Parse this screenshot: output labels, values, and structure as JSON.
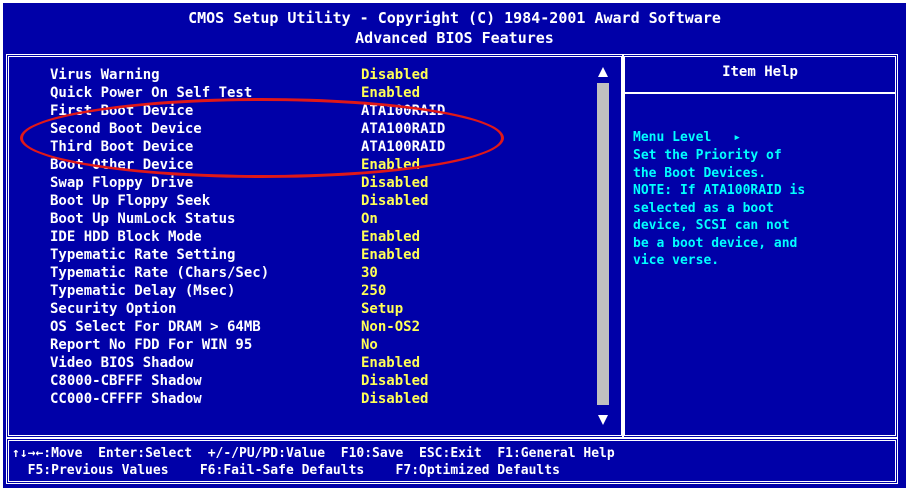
{
  "header": {
    "line1": "CMOS Setup Utility - Copyright (C) 1984-2001 Award Software",
    "line2": "Advanced BIOS Features"
  },
  "settings": [
    {
      "label": "Virus Warning",
      "value": "Disabled"
    },
    {
      "label": "Quick Power On Self Test",
      "value": "Enabled"
    },
    {
      "label": "First Boot Device",
      "value": "ATA100RAID"
    },
    {
      "label": "Second Boot Device",
      "value": "ATA100RAID"
    },
    {
      "label": "Third Boot Device",
      "value": "ATA100RAID"
    },
    {
      "label": "Boot Other Device",
      "value": "Enabled"
    },
    {
      "label": "Swap Floppy Drive",
      "value": "Disabled"
    },
    {
      "label": "Boot Up Floppy Seek",
      "value": "Disabled"
    },
    {
      "label": "Boot Up NumLock Status",
      "value": "On"
    },
    {
      "label": "IDE HDD Block Mode",
      "value": "Enabled"
    },
    {
      "label": "Typematic Rate Setting",
      "value": "Enabled"
    },
    {
      "label": "Typematic Rate (Chars/Sec)",
      "value": "30"
    },
    {
      "label": "Typematic Delay (Msec)",
      "value": "250"
    },
    {
      "label": "Security Option",
      "value": "Setup"
    },
    {
      "label": "OS Select For DRAM > 64MB",
      "value": "Non-OS2"
    },
    {
      "label": "Report No FDD For WIN 95",
      "value": "No"
    },
    {
      "label": "Video BIOS Shadow",
      "value": "Enabled"
    },
    {
      "label": "C8000-CBFFF Shadow",
      "value": "Disabled"
    },
    {
      "label": "CC000-CFFFF Shadow",
      "value": "Disabled"
    }
  ],
  "help": {
    "title": "Item Help",
    "menu_level": "Menu Level",
    "menu_level_arrow": "▸",
    "text": [
      "Set the Priority of",
      "the Boot Devices.",
      "NOTE: If ATA100RAID is",
      "selected as a boot",
      "device, SCSI can not",
      "be a boot device, and",
      "vice verse."
    ]
  },
  "status": {
    "move_key": "↑↓→←:Move",
    "select": "Enter:Select",
    "value": "+/-/PU/PD:Value",
    "save": "F10:Save",
    "exit": "ESC:Exit",
    "help": "F1:General Help",
    "previous": "F5:Previous Values",
    "failsafe": "F6:Fail-Safe Defaults",
    "optimized": "F7:Optimized Defaults"
  },
  "colors": {
    "background": "#0000a8",
    "value": "#ffff55",
    "help_text": "#00ffff",
    "annotation": "#e01818"
  },
  "icons": {
    "scroll_up": "triangle-up-icon",
    "scroll_down": "triangle-down-icon",
    "menu_level_arrow": "right-triangle-icon"
  }
}
